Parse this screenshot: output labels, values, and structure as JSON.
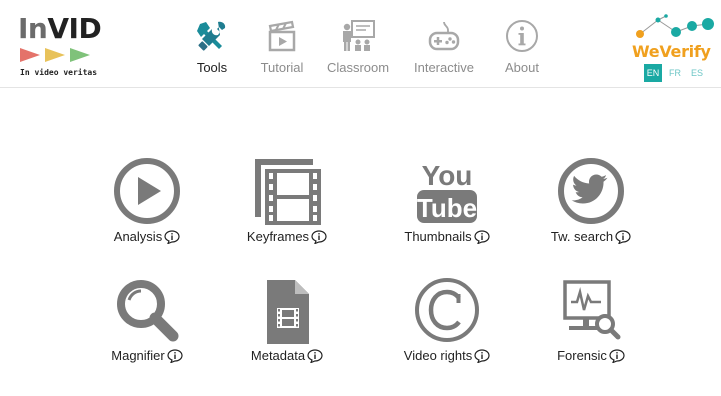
{
  "brand": {
    "name_part1": "In",
    "name_part2": "VID",
    "tagline": "In video veritas",
    "tri_colors": [
      "#e4736a",
      "#e8c25a",
      "#7fc27a"
    ]
  },
  "nav": [
    {
      "label": "Tools",
      "icon": "tools-icon",
      "active": true
    },
    {
      "label": "Tutorial",
      "icon": "clapperboard-icon",
      "active": false
    },
    {
      "label": "Classroom",
      "icon": "classroom-icon",
      "active": false
    },
    {
      "label": "Interactive",
      "icon": "gamepad-icon",
      "active": false
    },
    {
      "label": "About",
      "icon": "info-icon",
      "active": false
    }
  ],
  "partner": {
    "name": "WeVerify",
    "languages": [
      {
        "code": "EN",
        "active": true
      },
      {
        "code": "FR",
        "active": false
      },
      {
        "code": "ES",
        "active": false
      }
    ]
  },
  "tools": [
    {
      "label": "Analysis",
      "icon": "play-icon"
    },
    {
      "label": "Keyframes",
      "icon": "film-frames-icon"
    },
    {
      "label": "Thumbnails",
      "icon": "youtube-icon"
    },
    {
      "label": "Tw. search",
      "icon": "twitter-icon"
    },
    {
      "label": "Magnifier",
      "icon": "magnifier-icon"
    },
    {
      "label": "Metadata",
      "icon": "file-film-icon"
    },
    {
      "label": "Video rights",
      "icon": "copyright-icon"
    },
    {
      "label": "Forensic",
      "icon": "forensic-icon"
    }
  ],
  "colors": {
    "icon_gray": "#7a7a7a",
    "nav_teal": "#1a8c9a",
    "nav_gray": "#a8a8a8",
    "accent_orange": "#f0a01e",
    "accent_teal": "#1aa9a3"
  }
}
